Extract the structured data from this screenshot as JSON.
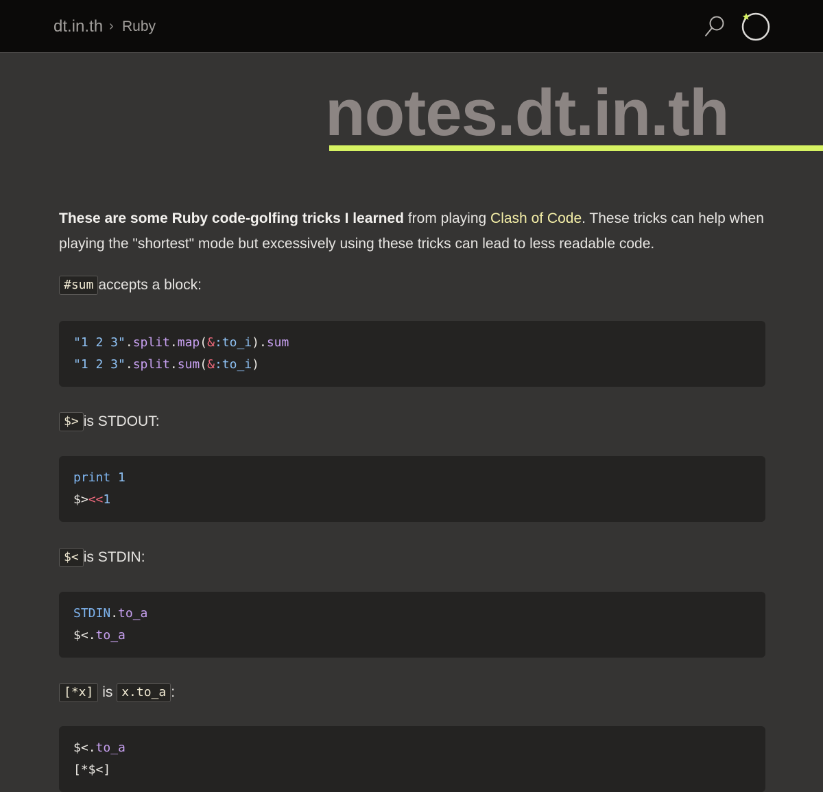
{
  "header": {
    "brand": "dt.in.th",
    "separator": "›",
    "breadcrumb": "Ruby"
  },
  "hero": {
    "title": "notes.dt.in.th",
    "accent_color": "#d6f262"
  },
  "intro": {
    "bold_1": "These are some ",
    "ruby_link": "Ruby",
    "bold_2": " code-golfing tricks I learned",
    "text_1": " from playing ",
    "clash_link": "Clash of Code",
    "text_2": ". These tricks can help when playing the \"shortest\" mode but excessively using these tricks can lead to less readable code."
  },
  "tips": [
    {
      "code": "#sum",
      "text": " accepts a block:",
      "lines": [
        [
          [
            "\"1 2 3\"",
            "str"
          ],
          [
            ".",
            "plain"
          ],
          [
            "split",
            "meth"
          ],
          [
            ".",
            "plain"
          ],
          [
            "map",
            "meth"
          ],
          [
            "(",
            "plain"
          ],
          [
            "&",
            "op"
          ],
          [
            ":to_i",
            "sym"
          ],
          [
            ")",
            "plain"
          ],
          [
            ".",
            "plain"
          ],
          [
            "sum",
            "meth"
          ]
        ],
        [
          [
            "\"1 2 3\"",
            "str"
          ],
          [
            ".",
            "plain"
          ],
          [
            "split",
            "meth"
          ],
          [
            ".",
            "plain"
          ],
          [
            "sum",
            "meth"
          ],
          [
            "(",
            "plain"
          ],
          [
            "&",
            "op"
          ],
          [
            ":to_i",
            "sym"
          ],
          [
            ")",
            "plain"
          ]
        ]
      ]
    },
    {
      "code": "$>",
      "text": " is STDOUT:",
      "lines": [
        [
          [
            "print",
            "kw"
          ],
          [
            " ",
            "plain"
          ],
          [
            "1",
            "num"
          ]
        ],
        [
          [
            "$>",
            "plain"
          ],
          [
            "<<",
            "op"
          ],
          [
            "1",
            "num"
          ]
        ]
      ]
    },
    {
      "code": "$<",
      "text": " is STDIN:",
      "lines": [
        [
          [
            "STDIN",
            "kw"
          ],
          [
            ".",
            "plain"
          ],
          [
            "to_a",
            "meth"
          ]
        ],
        [
          [
            "$<",
            "plain"
          ],
          [
            ".",
            "plain"
          ],
          [
            "to_a",
            "meth"
          ]
        ]
      ]
    },
    {
      "code": "[*x]",
      "text_mid": " is ",
      "code2": "x.to_a",
      "text": ":",
      "lines": [
        [
          [
            "$<",
            "plain"
          ],
          [
            ".",
            "plain"
          ],
          [
            "to_a",
            "meth"
          ]
        ],
        [
          [
            "[*$<]",
            "plain"
          ]
        ]
      ]
    }
  ]
}
